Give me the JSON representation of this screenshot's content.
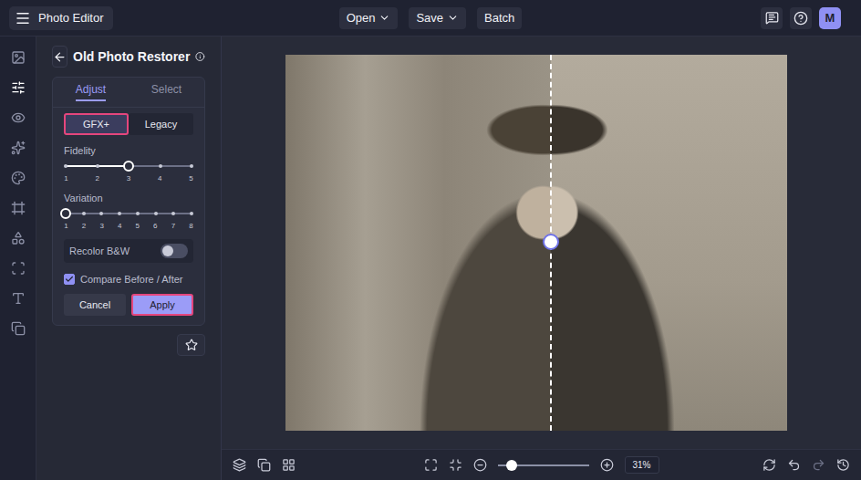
{
  "topbar": {
    "title": "Photo Editor",
    "menus": [
      {
        "label": "Open",
        "has_menu": true
      },
      {
        "label": "Save",
        "has_menu": true
      },
      {
        "label": "Batch",
        "has_menu": false
      }
    ],
    "avatar": "M"
  },
  "rail": [
    {
      "selected": false
    },
    {
      "selected": true
    },
    {
      "selected": false
    },
    {
      "selected": false
    },
    {
      "selected": false
    },
    {
      "selected": false
    },
    {
      "selected": false
    },
    {
      "selected": false
    },
    {
      "selected": false
    },
    {
      "selected": false
    }
  ],
  "panel": {
    "title": "Old Photo Restorer",
    "tabs": [
      {
        "label": "Adjust",
        "selected": true
      },
      {
        "label": "Select",
        "selected": false
      }
    ],
    "modes": [
      {
        "label": "GFX+",
        "selected": true,
        "highlighted": true
      },
      {
        "label": "Legacy",
        "selected": false,
        "highlighted": false
      }
    ],
    "sliders": [
      {
        "label": "Fidelity",
        "ticks": [
          "1",
          "2",
          "3",
          "4",
          "5"
        ],
        "level": 0.5
      },
      {
        "label": "Variation",
        "ticks": [
          "1",
          "2",
          "3",
          "4",
          "5",
          "6",
          "7",
          "8"
        ],
        "level": 0
      }
    ],
    "toggle": {
      "label": "Recolor B&W",
      "on": false
    },
    "checkbox": {
      "label": "Compare Before / After",
      "checked": true
    },
    "buttons": [
      {
        "label": "Cancel",
        "primary": false,
        "highlighted": false
      },
      {
        "label": "Apply",
        "primary": true,
        "highlighted": true
      }
    ]
  },
  "canvas": {
    "compare_level": 0.53
  },
  "bottombar": {
    "zoom": "31%",
    "zoom_level": 0.15
  }
}
